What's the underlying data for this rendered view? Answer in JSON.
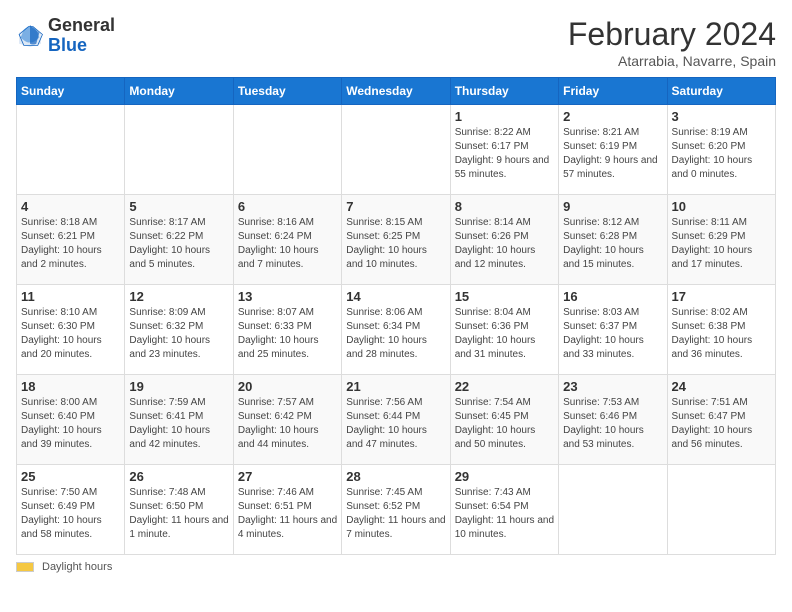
{
  "header": {
    "logo_general": "General",
    "logo_blue": "Blue",
    "month_year": "February 2024",
    "location": "Atarrabia, Navarre, Spain"
  },
  "footer": {
    "daylight_label": "Daylight hours"
  },
  "days_of_week": [
    "Sunday",
    "Monday",
    "Tuesday",
    "Wednesday",
    "Thursday",
    "Friday",
    "Saturday"
  ],
  "weeks": [
    [
      {
        "day": "",
        "info": ""
      },
      {
        "day": "",
        "info": ""
      },
      {
        "day": "",
        "info": ""
      },
      {
        "day": "",
        "info": ""
      },
      {
        "day": "1",
        "info": "Sunrise: 8:22 AM\nSunset: 6:17 PM\nDaylight: 9 hours and 55 minutes."
      },
      {
        "day": "2",
        "info": "Sunrise: 8:21 AM\nSunset: 6:19 PM\nDaylight: 9 hours and 57 minutes."
      },
      {
        "day": "3",
        "info": "Sunrise: 8:19 AM\nSunset: 6:20 PM\nDaylight: 10 hours and 0 minutes."
      }
    ],
    [
      {
        "day": "4",
        "info": "Sunrise: 8:18 AM\nSunset: 6:21 PM\nDaylight: 10 hours and 2 minutes."
      },
      {
        "day": "5",
        "info": "Sunrise: 8:17 AM\nSunset: 6:22 PM\nDaylight: 10 hours and 5 minutes."
      },
      {
        "day": "6",
        "info": "Sunrise: 8:16 AM\nSunset: 6:24 PM\nDaylight: 10 hours and 7 minutes."
      },
      {
        "day": "7",
        "info": "Sunrise: 8:15 AM\nSunset: 6:25 PM\nDaylight: 10 hours and 10 minutes."
      },
      {
        "day": "8",
        "info": "Sunrise: 8:14 AM\nSunset: 6:26 PM\nDaylight: 10 hours and 12 minutes."
      },
      {
        "day": "9",
        "info": "Sunrise: 8:12 AM\nSunset: 6:28 PM\nDaylight: 10 hours and 15 minutes."
      },
      {
        "day": "10",
        "info": "Sunrise: 8:11 AM\nSunset: 6:29 PM\nDaylight: 10 hours and 17 minutes."
      }
    ],
    [
      {
        "day": "11",
        "info": "Sunrise: 8:10 AM\nSunset: 6:30 PM\nDaylight: 10 hours and 20 minutes."
      },
      {
        "day": "12",
        "info": "Sunrise: 8:09 AM\nSunset: 6:32 PM\nDaylight: 10 hours and 23 minutes."
      },
      {
        "day": "13",
        "info": "Sunrise: 8:07 AM\nSunset: 6:33 PM\nDaylight: 10 hours and 25 minutes."
      },
      {
        "day": "14",
        "info": "Sunrise: 8:06 AM\nSunset: 6:34 PM\nDaylight: 10 hours and 28 minutes."
      },
      {
        "day": "15",
        "info": "Sunrise: 8:04 AM\nSunset: 6:36 PM\nDaylight: 10 hours and 31 minutes."
      },
      {
        "day": "16",
        "info": "Sunrise: 8:03 AM\nSunset: 6:37 PM\nDaylight: 10 hours and 33 minutes."
      },
      {
        "day": "17",
        "info": "Sunrise: 8:02 AM\nSunset: 6:38 PM\nDaylight: 10 hours and 36 minutes."
      }
    ],
    [
      {
        "day": "18",
        "info": "Sunrise: 8:00 AM\nSunset: 6:40 PM\nDaylight: 10 hours and 39 minutes."
      },
      {
        "day": "19",
        "info": "Sunrise: 7:59 AM\nSunset: 6:41 PM\nDaylight: 10 hours and 42 minutes."
      },
      {
        "day": "20",
        "info": "Sunrise: 7:57 AM\nSunset: 6:42 PM\nDaylight: 10 hours and 44 minutes."
      },
      {
        "day": "21",
        "info": "Sunrise: 7:56 AM\nSunset: 6:44 PM\nDaylight: 10 hours and 47 minutes."
      },
      {
        "day": "22",
        "info": "Sunrise: 7:54 AM\nSunset: 6:45 PM\nDaylight: 10 hours and 50 minutes."
      },
      {
        "day": "23",
        "info": "Sunrise: 7:53 AM\nSunset: 6:46 PM\nDaylight: 10 hours and 53 minutes."
      },
      {
        "day": "24",
        "info": "Sunrise: 7:51 AM\nSunset: 6:47 PM\nDaylight: 10 hours and 56 minutes."
      }
    ],
    [
      {
        "day": "25",
        "info": "Sunrise: 7:50 AM\nSunset: 6:49 PM\nDaylight: 10 hours and 58 minutes."
      },
      {
        "day": "26",
        "info": "Sunrise: 7:48 AM\nSunset: 6:50 PM\nDaylight: 11 hours and 1 minute."
      },
      {
        "day": "27",
        "info": "Sunrise: 7:46 AM\nSunset: 6:51 PM\nDaylight: 11 hours and 4 minutes."
      },
      {
        "day": "28",
        "info": "Sunrise: 7:45 AM\nSunset: 6:52 PM\nDaylight: 11 hours and 7 minutes."
      },
      {
        "day": "29",
        "info": "Sunrise: 7:43 AM\nSunset: 6:54 PM\nDaylight: 11 hours and 10 minutes."
      },
      {
        "day": "",
        "info": ""
      },
      {
        "day": "",
        "info": ""
      }
    ]
  ]
}
